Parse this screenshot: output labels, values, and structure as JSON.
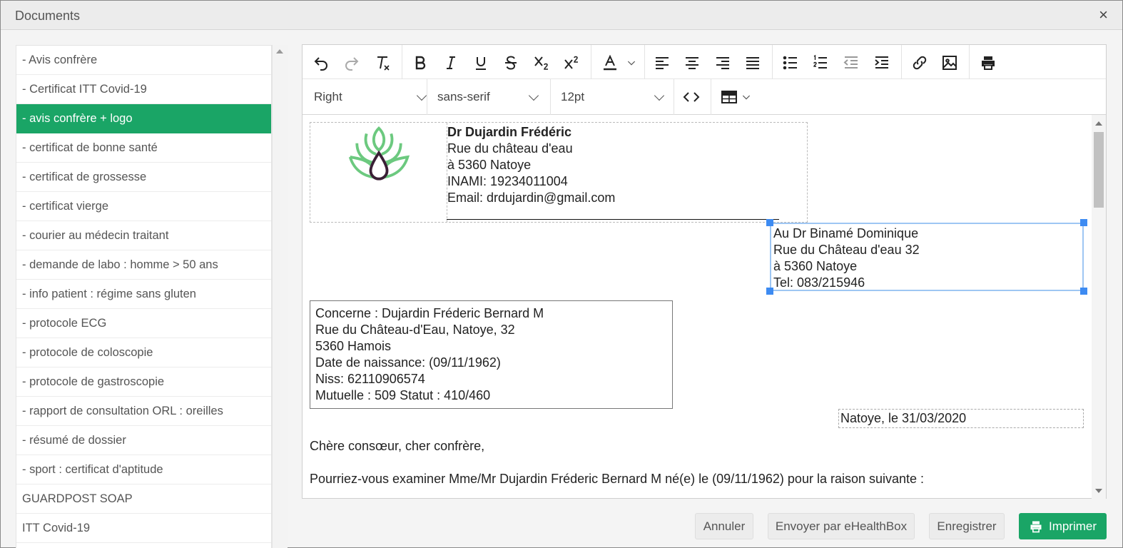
{
  "window": {
    "title": "Documents",
    "close_glyph": "×"
  },
  "sidebar": {
    "items": [
      {
        "label": "- Avis confrère",
        "active": false
      },
      {
        "label": "- Certificat ITT Covid-19",
        "active": false
      },
      {
        "label": "- avis confrère + logo",
        "active": true
      },
      {
        "label": "- certificat de bonne santé",
        "active": false
      },
      {
        "label": "- certificat de grossesse",
        "active": false
      },
      {
        "label": "- certificat vierge",
        "active": false
      },
      {
        "label": "- courier au médecin traitant",
        "active": false
      },
      {
        "label": "- demande de labo : homme > 50 ans",
        "active": false
      },
      {
        "label": "- info patient : régime sans gluten",
        "active": false
      },
      {
        "label": "- protocole ECG",
        "active": false
      },
      {
        "label": "- protocole de coloscopie",
        "active": false
      },
      {
        "label": "- protocole de gastroscopie",
        "active": false
      },
      {
        "label": "- rapport de consultation ORL : oreilles",
        "active": false
      },
      {
        "label": "- résumé de dossier",
        "active": false
      },
      {
        "label": "- sport : certificat d'aptitude",
        "active": false
      },
      {
        "label": "GUARDPOST SOAP",
        "active": false
      },
      {
        "label": "ITT Covid-19",
        "active": false
      }
    ]
  },
  "toolbar": {
    "icons": [
      "undo-icon",
      "redo-icon",
      "clear-formatting-icon",
      "bold-icon",
      "italic-icon",
      "underline-icon",
      "strikethrough-icon",
      "subscript-icon",
      "superscript-icon",
      "text-color-icon",
      "align-left-icon",
      "align-center-icon",
      "align-right-icon",
      "justify-icon",
      "bullet-list-icon",
      "numbered-list-icon",
      "outdent-icon",
      "indent-icon",
      "link-icon",
      "image-icon",
      "print-icon",
      "source-code-icon",
      "table-icon"
    ],
    "format_value": "Right",
    "font_value": "sans-serif",
    "size_value": "12pt",
    "code_label": "<>"
  },
  "document": {
    "doctor": {
      "name": "Dr Dujardin Frédéric",
      "street": "Rue du château d'eau",
      "city": "à 5360 Natoye",
      "inami": "INAMI: 19234011004",
      "email": "Email: drdujardin@gmail.com",
      "underline": "___________________________________________________"
    },
    "addressee": {
      "line1": "Au Dr Binamé Dominique",
      "line2": "Rue du Château d'eau 32",
      "line3": "à 5360 Natoye",
      "line4": "Tel: 083/215946"
    },
    "patient": {
      "line1": "Concerne : Dujardin Fréderic Bernard M",
      "line2": "Rue du Château-d'Eau, Natoye, 32",
      "line3": "5360 Hamois",
      "line4": "Date de naissance: (09/11/1962)",
      "line5": "Niss: 62110906574",
      "line6": "Mutuelle : 509 Statut : 410/460"
    },
    "date_line": "Natoye, le 31/03/2020",
    "greeting": "Chère consœur, cher confrère,",
    "request": "Pourriez-vous examiner Mme/Mr Dujardin Fréderic Bernard M né(e) le (09/11/1962) pour la raison suivante :"
  },
  "footer": {
    "cancel": "Annuler",
    "send": "Envoyer par eHealthBox",
    "save": "Enregistrer",
    "print": "Imprimer"
  },
  "colors": {
    "accent_green": "#1aa566",
    "selection_blue": "#3d8bf2",
    "logo_green": "#6cc97f",
    "logo_dark": "#3a1f35"
  }
}
